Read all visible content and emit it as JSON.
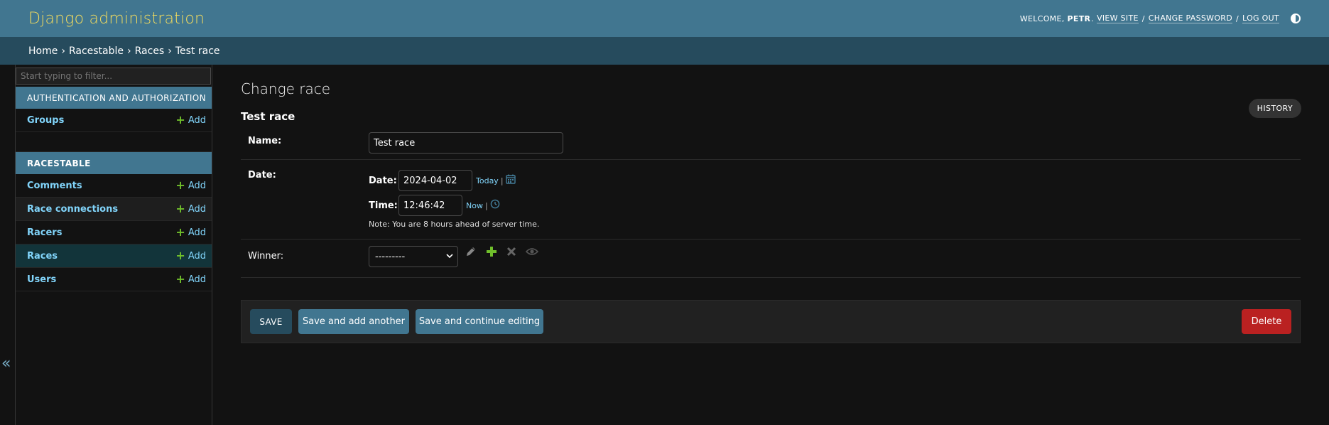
{
  "header": {
    "branding": "Django administration",
    "welcome_label": "WELCOME,",
    "username": "PETR",
    "view_site": "VIEW SITE",
    "change_password": "CHANGE PASSWORD",
    "log_out": "LOG OUT",
    "separator": "/",
    "theme_icon": "half-circle-icon"
  },
  "breadcrumbs": {
    "items": [
      "Home",
      "Racestable",
      "Races"
    ],
    "current": "Test race",
    "separator": "›"
  },
  "sidebar": {
    "filter_placeholder": "Start typing to filter...",
    "collapse_glyph": "«",
    "modules": [
      {
        "caption": "AUTHENTICATION AND AUTHORIZATION",
        "items": [
          {
            "label": "Groups",
            "add": "Add"
          }
        ]
      },
      {
        "caption": "RACESTABLE",
        "items": [
          {
            "label": "Comments",
            "add": "Add"
          },
          {
            "label": "Race connections",
            "add": "Add"
          },
          {
            "label": "Racers",
            "add": "Add"
          },
          {
            "label": "Races",
            "add": "Add"
          },
          {
            "label": "Users",
            "add": "Add"
          }
        ]
      }
    ]
  },
  "content": {
    "title": "Change race",
    "object_title": "Test race",
    "history_button": "HISTORY",
    "fields": {
      "name": {
        "label": "Name:",
        "value": "Test race"
      },
      "date": {
        "label": "Date:",
        "date_label": "Date:",
        "date_value": "2024-04-02",
        "today_link": "Today",
        "time_label": "Time:",
        "time_value": "12:46:42",
        "now_link": "Now",
        "shortcut_sep": "|",
        "note": "Note: You are 8 hours ahead of server time."
      },
      "winner": {
        "label": "Winner:",
        "selected": "---------"
      }
    },
    "submit_row": {
      "save": "SAVE",
      "save_add_another": "Save and add another",
      "save_continue": "Save and continue editing",
      "delete": "Delete"
    }
  },
  "colors": {
    "header_bg": "#417690",
    "breadcrumb_bg": "#264b5d",
    "branding": "#f5dd5d",
    "link": "#81d4fa",
    "add_plus": "#70bf2b",
    "delete": "#ba2121",
    "page_bg": "#121212"
  }
}
